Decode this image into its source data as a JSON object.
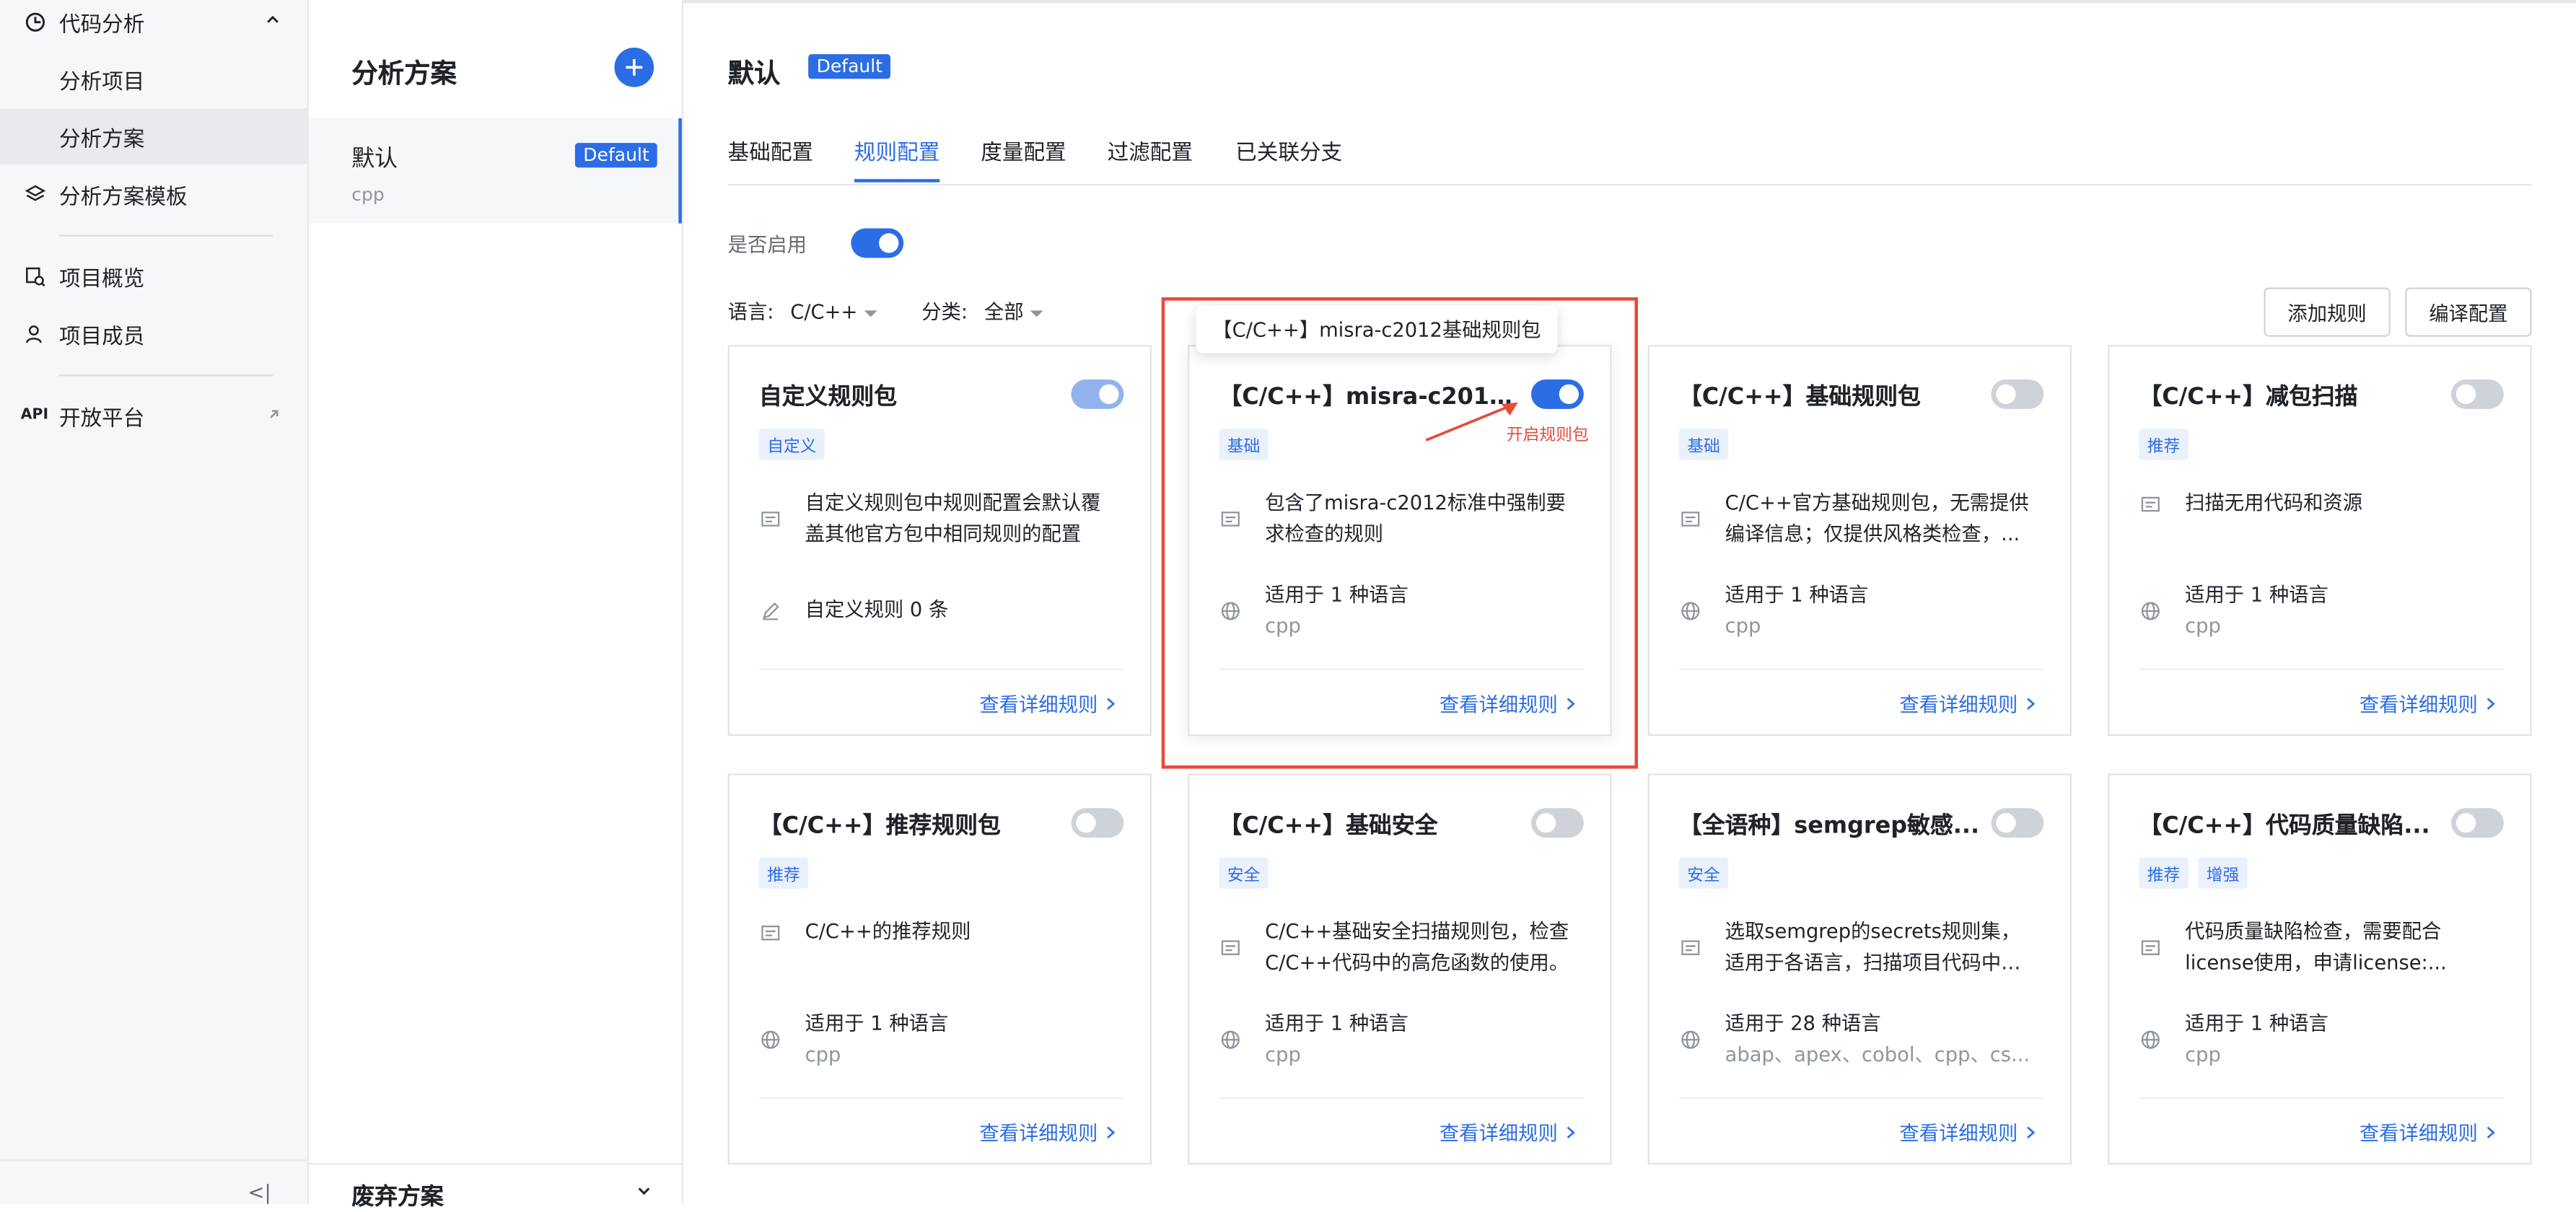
{
  "nav": {
    "items": [
      {
        "label": "代码分析",
        "icon": "code-analysis-icon"
      },
      {
        "label": "分析项目"
      },
      {
        "label": "分析方案"
      },
      {
        "label": "分析方案模板",
        "icon": "layers-icon"
      },
      {
        "label": "项目概览",
        "icon": "overview-icon"
      },
      {
        "label": "项目成员",
        "icon": "members-icon"
      },
      {
        "label": "开放平台",
        "icon": "API"
      }
    ],
    "collapse": "<|"
  },
  "plans": {
    "title": "分析方案",
    "item": {
      "name": "默认",
      "badge": "Default",
      "lang": "cpp"
    },
    "deprecated": "废弃方案"
  },
  "main": {
    "title": "默认",
    "badge": "Default",
    "tabs": [
      "基础配置",
      "规则配置",
      "度量配置",
      "过滤配置",
      "已关联分支"
    ],
    "enable_label": "是否启用",
    "lang_label": "语言:",
    "lang_value": "C/C++",
    "cat_label": "分类:",
    "cat_value": "全部",
    "add_rule": "添加规则",
    "edit_config": "编译配置",
    "detail": "查看详细规则"
  },
  "cards": [
    {
      "title": "自定义规则包",
      "toggle": "dim",
      "tags": [
        "自定义"
      ],
      "desc": "自定义规则包中规则配置会默认覆盖其他官方包中相同规则的配置",
      "meta": "自定义规则 0 条",
      "sub": ""
    },
    {
      "title": "【C/C++】misra-c2012...",
      "toggle": "on",
      "tags": [
        "基础"
      ],
      "desc": "包含了misra-c2012标准中强制要求检查的规则",
      "meta": "适用于 1 种语言",
      "sub": "cpp"
    },
    {
      "title": "【C/C++】基础规则包",
      "toggle": "off",
      "tags": [
        "基础"
      ],
      "desc": "C/C++官方基础规则包，无需提供编译信息；仅提供风格类检查，...",
      "meta": "适用于 1 种语言",
      "sub": "cpp"
    },
    {
      "title": "【C/C++】减包扫描",
      "toggle": "off",
      "tags": [
        "推荐"
      ],
      "desc": "扫描无用代码和资源",
      "meta": "适用于 1 种语言",
      "sub": "cpp"
    },
    {
      "title": "【C/C++】推荐规则包",
      "toggle": "off",
      "tags": [
        "推荐"
      ],
      "desc": "C/C++的推荐规则",
      "meta": "适用于 1 种语言",
      "sub": "cpp"
    },
    {
      "title": "【C/C++】基础安全",
      "toggle": "off",
      "tags": [
        "安全"
      ],
      "desc": "C/C++基础安全扫描规则包，检查C/C++代码中的高危函数的使用。",
      "meta": "适用于 1 种语言",
      "sub": "cpp"
    },
    {
      "title": "【全语种】semgrep敏感...",
      "toggle": "off",
      "tags": [
        "安全"
      ],
      "desc": "选取semgrep的secrets规则集，适用于各语言，扫描项目代码中的...",
      "meta": "适用于 28 种语言",
      "sub": "abap、apex、cobol、cpp、cs..."
    },
    {
      "title": "【C/C++】代码质量缺陷...",
      "toggle": "off",
      "tags": [
        "推荐",
        "增强"
      ],
      "desc": "代码质量缺陷检查，需要配合license使用，申请license:...",
      "meta": "适用于 1 种语言",
      "sub": "cpp"
    }
  ],
  "annotation": {
    "tooltip": "【C/C++】misra-c2012基础规则包",
    "text": "开启规则包",
    "color": "#e64b3b"
  },
  "colors": {
    "accent": "#2b6de5"
  }
}
